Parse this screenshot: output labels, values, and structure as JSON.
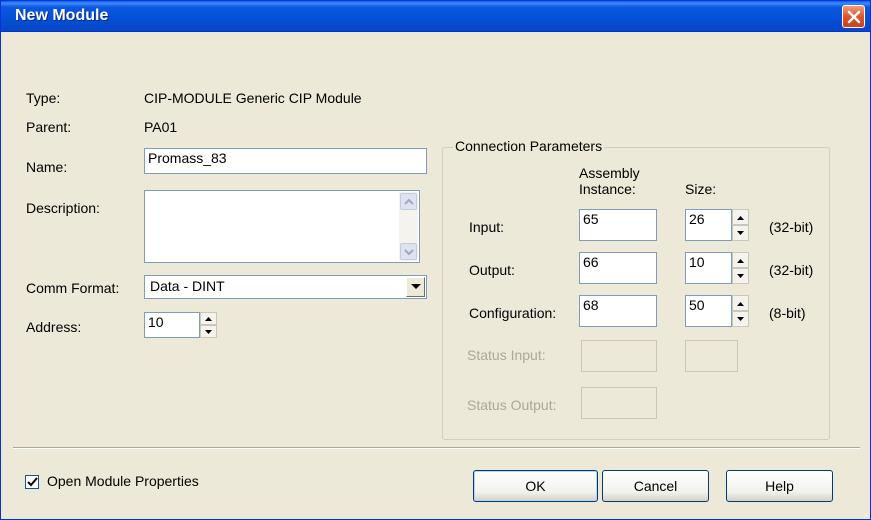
{
  "window": {
    "title": "New Module"
  },
  "labels": {
    "type": "Type:",
    "parent": "Parent:",
    "name": "Name:",
    "description": "Description:",
    "comm_format": "Comm Format:",
    "address": "Address:"
  },
  "values": {
    "type": "CIP-MODULE Generic CIP Module",
    "parent": "PA01",
    "name": "Promass_83",
    "description": "",
    "comm_format": "Data - DINT",
    "address": "10"
  },
  "connection": {
    "title": "Connection Parameters",
    "assembly_header_1": "Assembly",
    "assembly_header_2": "Instance:",
    "size_header": "Size:",
    "rows": [
      {
        "label": "Input:",
        "instance": "65",
        "size": "26",
        "unit": "(32-bit)"
      },
      {
        "label": "Output:",
        "instance": "66",
        "size": "10",
        "unit": "(32-bit)"
      },
      {
        "label": "Configuration:",
        "instance": "68",
        "size": "50",
        "unit": "(8-bit)"
      }
    ],
    "status_input_label": "Status Input:",
    "status_output_label": "Status Output:"
  },
  "footer": {
    "open_properties_label": "Open Module Properties",
    "open_properties_checked": true,
    "ok_label": "OK",
    "cancel_label": "Cancel",
    "help_label": "Help"
  }
}
